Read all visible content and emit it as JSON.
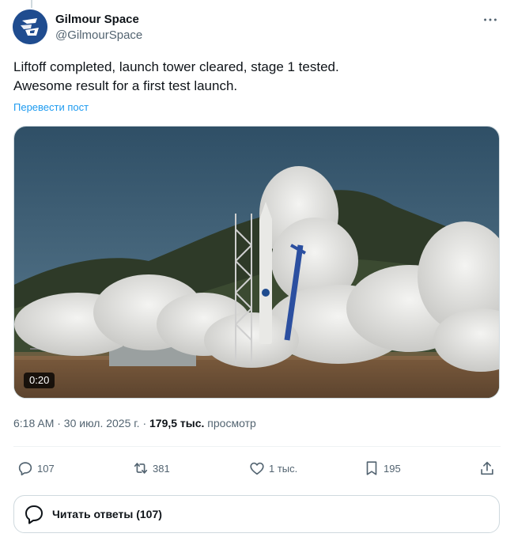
{
  "author": {
    "display_name": "Gilmour Space",
    "handle": "@GilmourSpace",
    "avatar_icon": "gilmour-logo-icon",
    "avatar_color": "#1f4c8f"
  },
  "tweet": {
    "text_line1": "Liftoff completed, launch tower cleared, stage 1 tested.",
    "text_line2": "Awesome result for a first test launch.",
    "translate_label": "Перевести пост"
  },
  "media": {
    "duration": "0:20"
  },
  "meta": {
    "timestamp": "6:18 AM · 30 июл. 2025 г. · ",
    "views_count": "179,5 тыс.",
    "views_label": " просмотр"
  },
  "actions": {
    "replies": "107",
    "reposts": "381",
    "likes": "1 тыс.",
    "bookmarks": "195"
  },
  "read_replies": {
    "label": "Читать ответы (107)"
  },
  "colors": {
    "link": "#1d9bf0",
    "secondary_text": "#536471",
    "primary_text": "#0f1419"
  }
}
